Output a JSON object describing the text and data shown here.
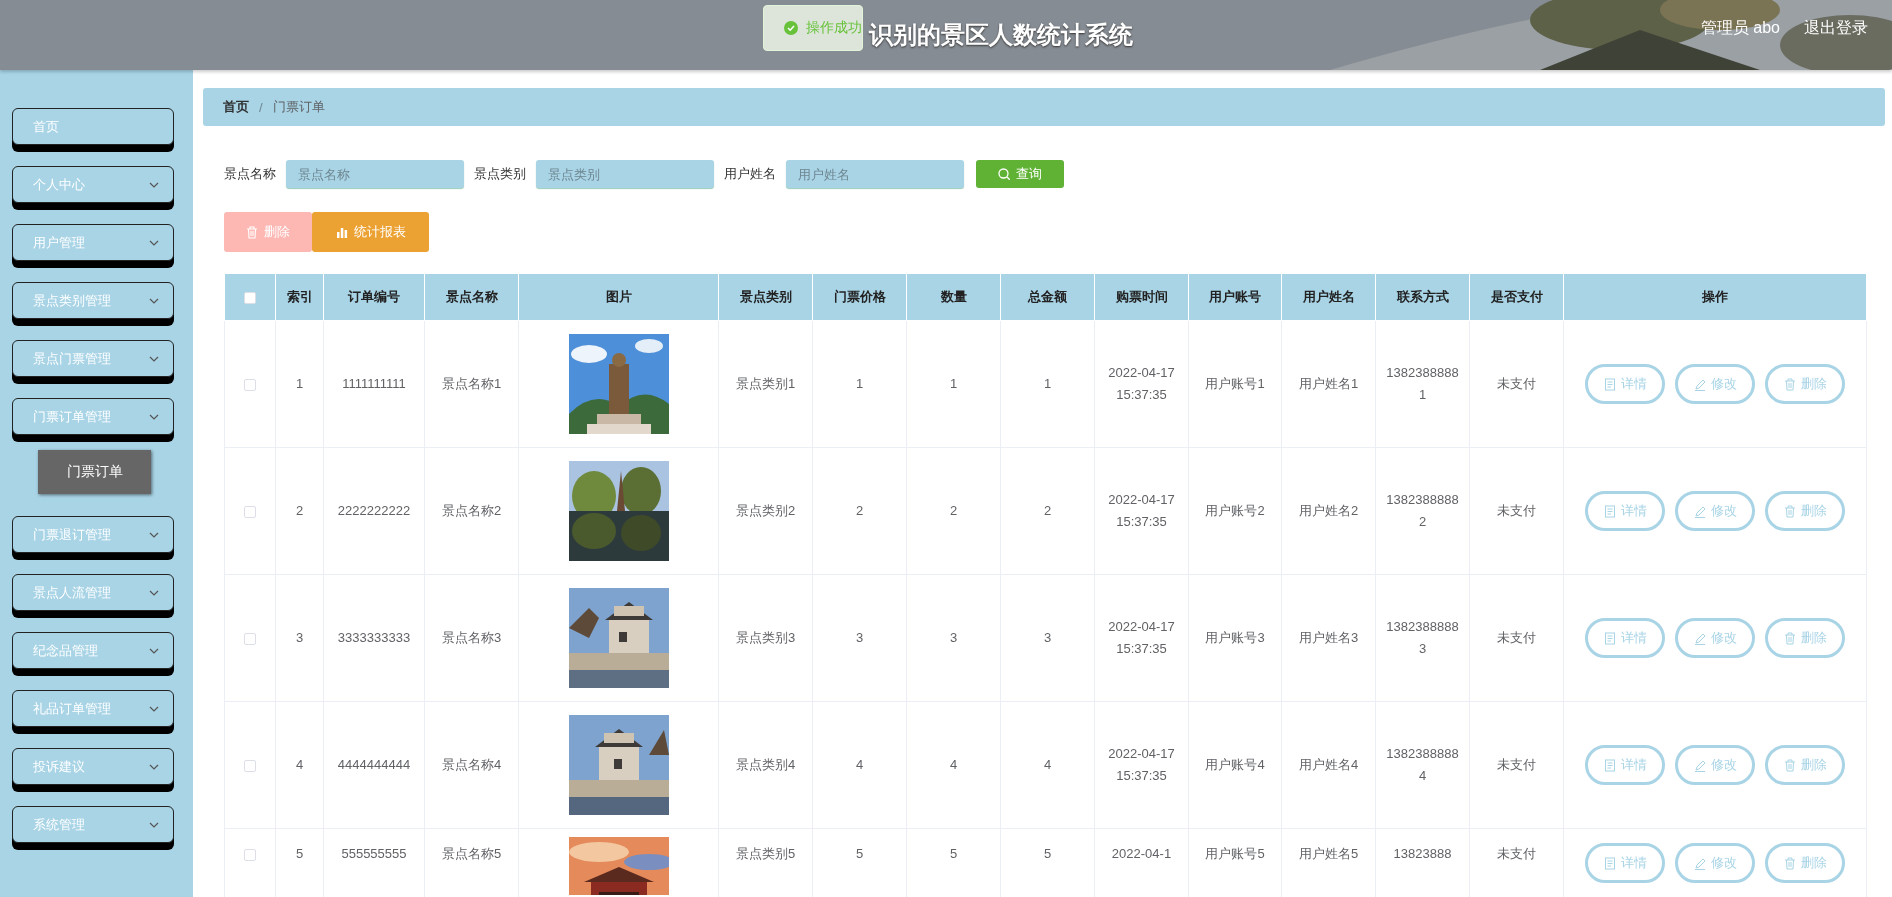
{
  "header": {
    "title": "识别的景区人数统计系统",
    "user": "管理员 abo",
    "logout": "退出登录"
  },
  "toast": {
    "message": "操作成功"
  },
  "sidebar": {
    "items": [
      {
        "label": "首页",
        "kind": "link"
      },
      {
        "label": "个人中心",
        "kind": "menu"
      },
      {
        "label": "用户管理",
        "kind": "menu"
      },
      {
        "label": "景点类别管理",
        "kind": "menu"
      },
      {
        "label": "景点门票管理",
        "kind": "menu"
      },
      {
        "label": "门票订单管理",
        "kind": "menu",
        "children": [
          {
            "label": "门票订单",
            "selected": true
          }
        ]
      },
      {
        "label": "门票退订管理",
        "kind": "menu"
      },
      {
        "label": "景点人流管理",
        "kind": "menu"
      },
      {
        "label": "纪念品管理",
        "kind": "menu"
      },
      {
        "label": "礼品订单管理",
        "kind": "menu"
      },
      {
        "label": "投诉建议",
        "kind": "menu"
      },
      {
        "label": "系统管理",
        "kind": "menu"
      }
    ]
  },
  "breadcrumb": {
    "items": [
      {
        "label": "首页"
      },
      {
        "label": "门票订单"
      }
    ],
    "separator": "/"
  },
  "search": {
    "fields": [
      {
        "label": "景点名称",
        "placeholder": "景点名称"
      },
      {
        "label": "景点类别",
        "placeholder": "景点类别"
      },
      {
        "label": "用户姓名",
        "placeholder": "用户姓名"
      }
    ],
    "button": "查询"
  },
  "actions": [
    {
      "label": "删除",
      "kind": "delete",
      "disabled": true
    },
    {
      "label": "统计报表",
      "kind": "report",
      "disabled": false
    }
  ],
  "table": {
    "all_selected": false,
    "columns": [
      "索引",
      "订单编号",
      "景点名称",
      "图片",
      "景点类别",
      "门票价格",
      "数量",
      "总金额",
      "购票时间",
      "用户账号",
      "用户姓名",
      "联系方式",
      "是否支付",
      "操作"
    ],
    "rows": [
      {
        "selected": false,
        "index": "1",
        "order_no": "1111111111",
        "name": "景点名称1",
        "category": "景点类别1",
        "price": "1",
        "quantity": "1",
        "total": "1",
        "time": "2022-04-17 15:37:35",
        "account": "用户账号1",
        "user_name": "用户姓名1",
        "phone": "13823888881",
        "paid": "未支付",
        "actions": [
          "详情",
          "修改",
          "删除"
        ]
      },
      {
        "selected": false,
        "index": "2",
        "order_no": "2222222222",
        "name": "景点名称2",
        "category": "景点类别2",
        "price": "2",
        "quantity": "2",
        "total": "2",
        "time": "2022-04-17 15:37:35",
        "account": "用户账号2",
        "user_name": "用户姓名2",
        "phone": "13823888882",
        "paid": "未支付",
        "actions": [
          "详情",
          "修改",
          "删除"
        ]
      },
      {
        "selected": false,
        "index": "3",
        "order_no": "3333333333",
        "name": "景点名称3",
        "category": "景点类别3",
        "price": "3",
        "quantity": "3",
        "total": "3",
        "time": "2022-04-17 15:37:35",
        "account": "用户账号3",
        "user_name": "用户姓名3",
        "phone": "13823888883",
        "paid": "未支付",
        "actions": [
          "详情",
          "修改",
          "删除"
        ]
      },
      {
        "selected": false,
        "index": "4",
        "order_no": "4444444444",
        "name": "景点名称4",
        "category": "景点类别4",
        "price": "4",
        "quantity": "4",
        "total": "4",
        "time": "2022-04-17 15:37:35",
        "account": "用户账号4",
        "user_name": "用户姓名4",
        "phone": "13823888884",
        "paid": "未支付",
        "actions": [
          "详情",
          "修改",
          "删除"
        ]
      },
      {
        "selected": false,
        "index": "5",
        "order_no": "555555555",
        "name": "景点名称5",
        "category": "景点类别5",
        "price": "5",
        "quantity": "5",
        "total": "5",
        "time": "2022-04-1",
        "account": "用户账号5",
        "user_name": "用户姓名5",
        "phone": "13823888",
        "paid": "未支付",
        "actions": [
          "详情",
          "修改",
          "删除"
        ]
      }
    ]
  }
}
